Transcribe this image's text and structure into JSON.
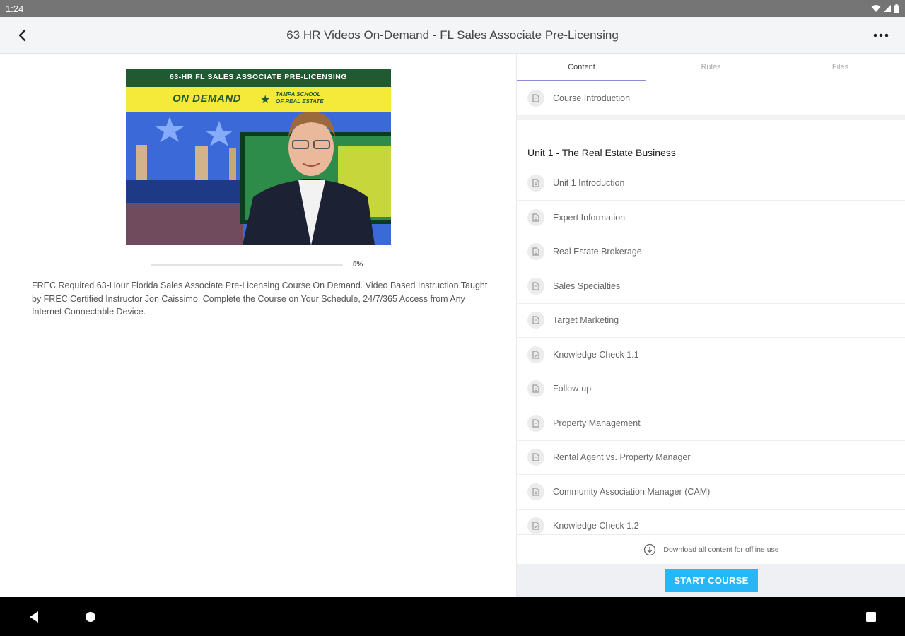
{
  "status_bar": {
    "time": "1:24"
  },
  "app_bar": {
    "title": "63 HR Videos On-Demand - FL Sales Associate Pre-Licensing"
  },
  "course": {
    "banner_top": "63-HR FL SALES ASSOCIATE PRE-LICENSING",
    "banner_mid": "ON DEMAND",
    "banner_logo_line1": "TAMPA SCHOOL",
    "banner_logo_line2": "OF REAL ESTATE",
    "progress_percent": 0,
    "progress_label": "0%",
    "description": "FREC Required 63-Hour Florida Sales Associate Pre-Licensing Course On Demand. Video Based Instruction Taught by FREC Certified Instructor Jon Caissimo. Complete the Course on Your Schedule, 24/7/365 Access from Any Internet Connectable Device."
  },
  "tabs": [
    {
      "label": "Content",
      "active": true
    },
    {
      "label": "Rules",
      "active": false
    },
    {
      "label": "Files",
      "active": false
    }
  ],
  "content": {
    "intro_item": "Course Introduction",
    "unit_title": "Unit 1 - The Real Estate Business",
    "items": [
      {
        "label": "Unit 1 Introduction",
        "icon": "document-icon"
      },
      {
        "label": "Expert Information",
        "icon": "document-icon"
      },
      {
        "label": "Real Estate Brokerage",
        "icon": "document-icon"
      },
      {
        "label": "Sales Specialties",
        "icon": "document-icon"
      },
      {
        "label": "Target Marketing",
        "icon": "document-icon"
      },
      {
        "label": "Knowledge Check 1.1",
        "icon": "quiz-icon"
      },
      {
        "label": "Follow-up",
        "icon": "document-icon"
      },
      {
        "label": "Property Management",
        "icon": "document-icon"
      },
      {
        "label": "Rental Agent vs. Property Manager",
        "icon": "document-icon"
      },
      {
        "label": "Community Association Manager (CAM)",
        "icon": "document-icon"
      },
      {
        "label": "Knowledge Check 1.2",
        "icon": "quiz-icon"
      }
    ]
  },
  "download": {
    "label": "Download all content for offline use"
  },
  "footer": {
    "start_label": "START COURSE"
  },
  "colors": {
    "accent": "#29b6f6",
    "tab_indicator": "#8e8ed8",
    "banner_green": "#1f5a32",
    "banner_yellow": "#f5ea3a"
  }
}
